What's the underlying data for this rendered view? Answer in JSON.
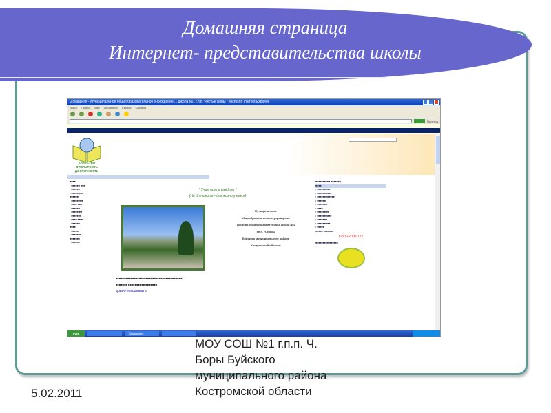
{
  "slide": {
    "title_line1": "Домашняя страница",
    "title_line2": "Интернет- представительства школы",
    "footer_lines": [
      "МОУ СОШ №1 г.п.п. Ч.",
      "Боры Буйского",
      "муниципального района",
      "Костромской области"
    ],
    "date": "5.02.2011",
    "colors": {
      "banner": "#6666cc",
      "frame": "#5f9a96"
    }
  },
  "browser": {
    "window_title": "Домашняя - Муниципальное общеобразовательное учреждение ... школа №1 г.п.п. Чистые Боры - Microsoft Internet Explorer",
    "menu": [
      "Файл",
      "Правка",
      "Вид",
      "Избранное",
      "Сервис",
      "Справка"
    ],
    "go_label": "Переход",
    "logo_text": [
      "КАЧЕСТВО",
      "ОТКРЫТОСТЬ",
      "ДОСТУПНОСТЬ"
    ],
    "motto_1": "\" Учим всех и каждого \"",
    "motto_2": "(Не для школы - для жизни учимся)",
    "school_name": [
      "Муниципальное",
      "общеобразовательное учреждение",
      "средняя общеобразовательная школа №1",
      "г.п.п. Ч. Боры",
      "Буйского муниципального района",
      "Костромской области"
    ],
    "phone": "8-800-2000-122",
    "welcome": "ДОБРО ПОЖАЛОВАТЬ",
    "taskbar": {
      "start": "пуск",
      "tasks": [
        "Домашняя - Micros..."
      ]
    }
  }
}
